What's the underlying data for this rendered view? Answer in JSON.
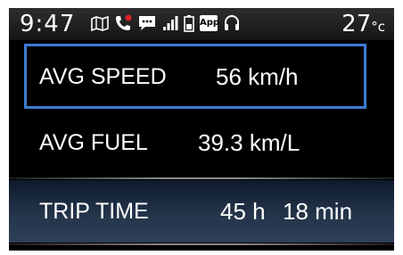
{
  "status": {
    "time": "9:47",
    "temperature": "27",
    "temperature_unit": "°c",
    "app_badge": "App",
    "icons": [
      "map-icon",
      "phone-icon",
      "message-icon",
      "signal-icon",
      "battery-icon",
      "app-icon",
      "headset-icon"
    ]
  },
  "rows": [
    {
      "label": "AVG SPEED",
      "value": "56 km/h",
      "selected": true
    },
    {
      "label": "AVG FUEL",
      "value": "39.3 km/L",
      "selected": false
    },
    {
      "label": "TRIP TIME",
      "hours": "45 h",
      "minutes": "18 min",
      "selected": false
    }
  ],
  "colors": {
    "selection_border": "#3f7bd2",
    "phone_icon": "#e0202a",
    "background": "#000000",
    "text": "#ffffff"
  }
}
